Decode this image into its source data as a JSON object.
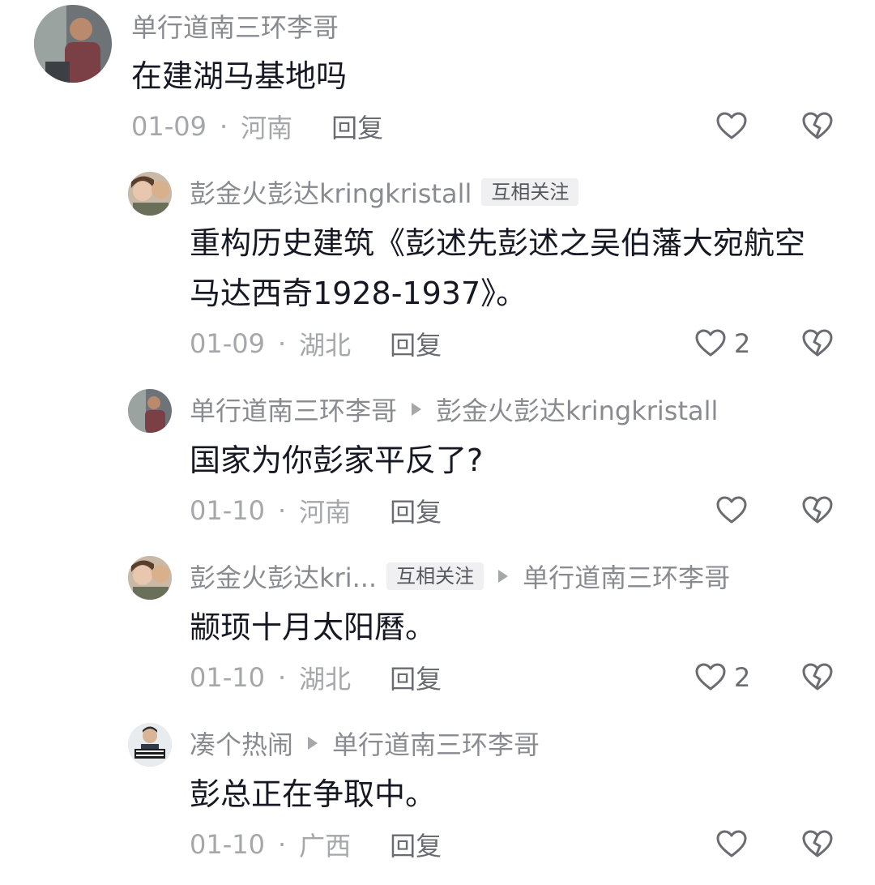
{
  "comments": [
    {
      "author": "单行道南三环李哥",
      "text": "在建湖马基地吗",
      "date": "01-09",
      "dot": "·",
      "location": "河南",
      "reply": "回复"
    },
    {
      "author": "彭金火彭达kringkristall",
      "tag": "互相关注",
      "text_line1": "重构历史建筑《彭述先彭述之吴伯藩大宛航空",
      "text_line2": "马达西奇1928-1937》。",
      "date": "01-09",
      "dot": "·",
      "location": "湖北",
      "reply": "回复",
      "likes": "2"
    },
    {
      "author": "单行道南三环李哥",
      "reply_to": "彭金火彭达kringkristall",
      "text": "国家为你彭家平反了?",
      "date": "01-10",
      "dot": "·",
      "location": "河南",
      "reply": "回复"
    },
    {
      "author": "彭金火彭达kri...",
      "tag": "互相关注",
      "reply_to": "单行道南三环李哥",
      "text": "颛顼十月太阳曆。",
      "date": "01-10",
      "dot": "·",
      "location": "湖北",
      "reply": "回复",
      "likes": "2"
    },
    {
      "author": "凑个热闹",
      "reply_to": "单行道南三环李哥",
      "text": "彭总正在争取中。",
      "date": "01-10",
      "dot": "·",
      "location": "广西",
      "reply": "回复"
    }
  ],
  "icons": {
    "like": "heart-outline-icon",
    "dislike": "broken-heart-icon",
    "reply_arrow": "triangle-right-icon"
  },
  "colors": {
    "name": "#8a8b91",
    "text": "#161823",
    "meta": "#a6a7ab",
    "tag_bg": "#f0f0f2"
  }
}
